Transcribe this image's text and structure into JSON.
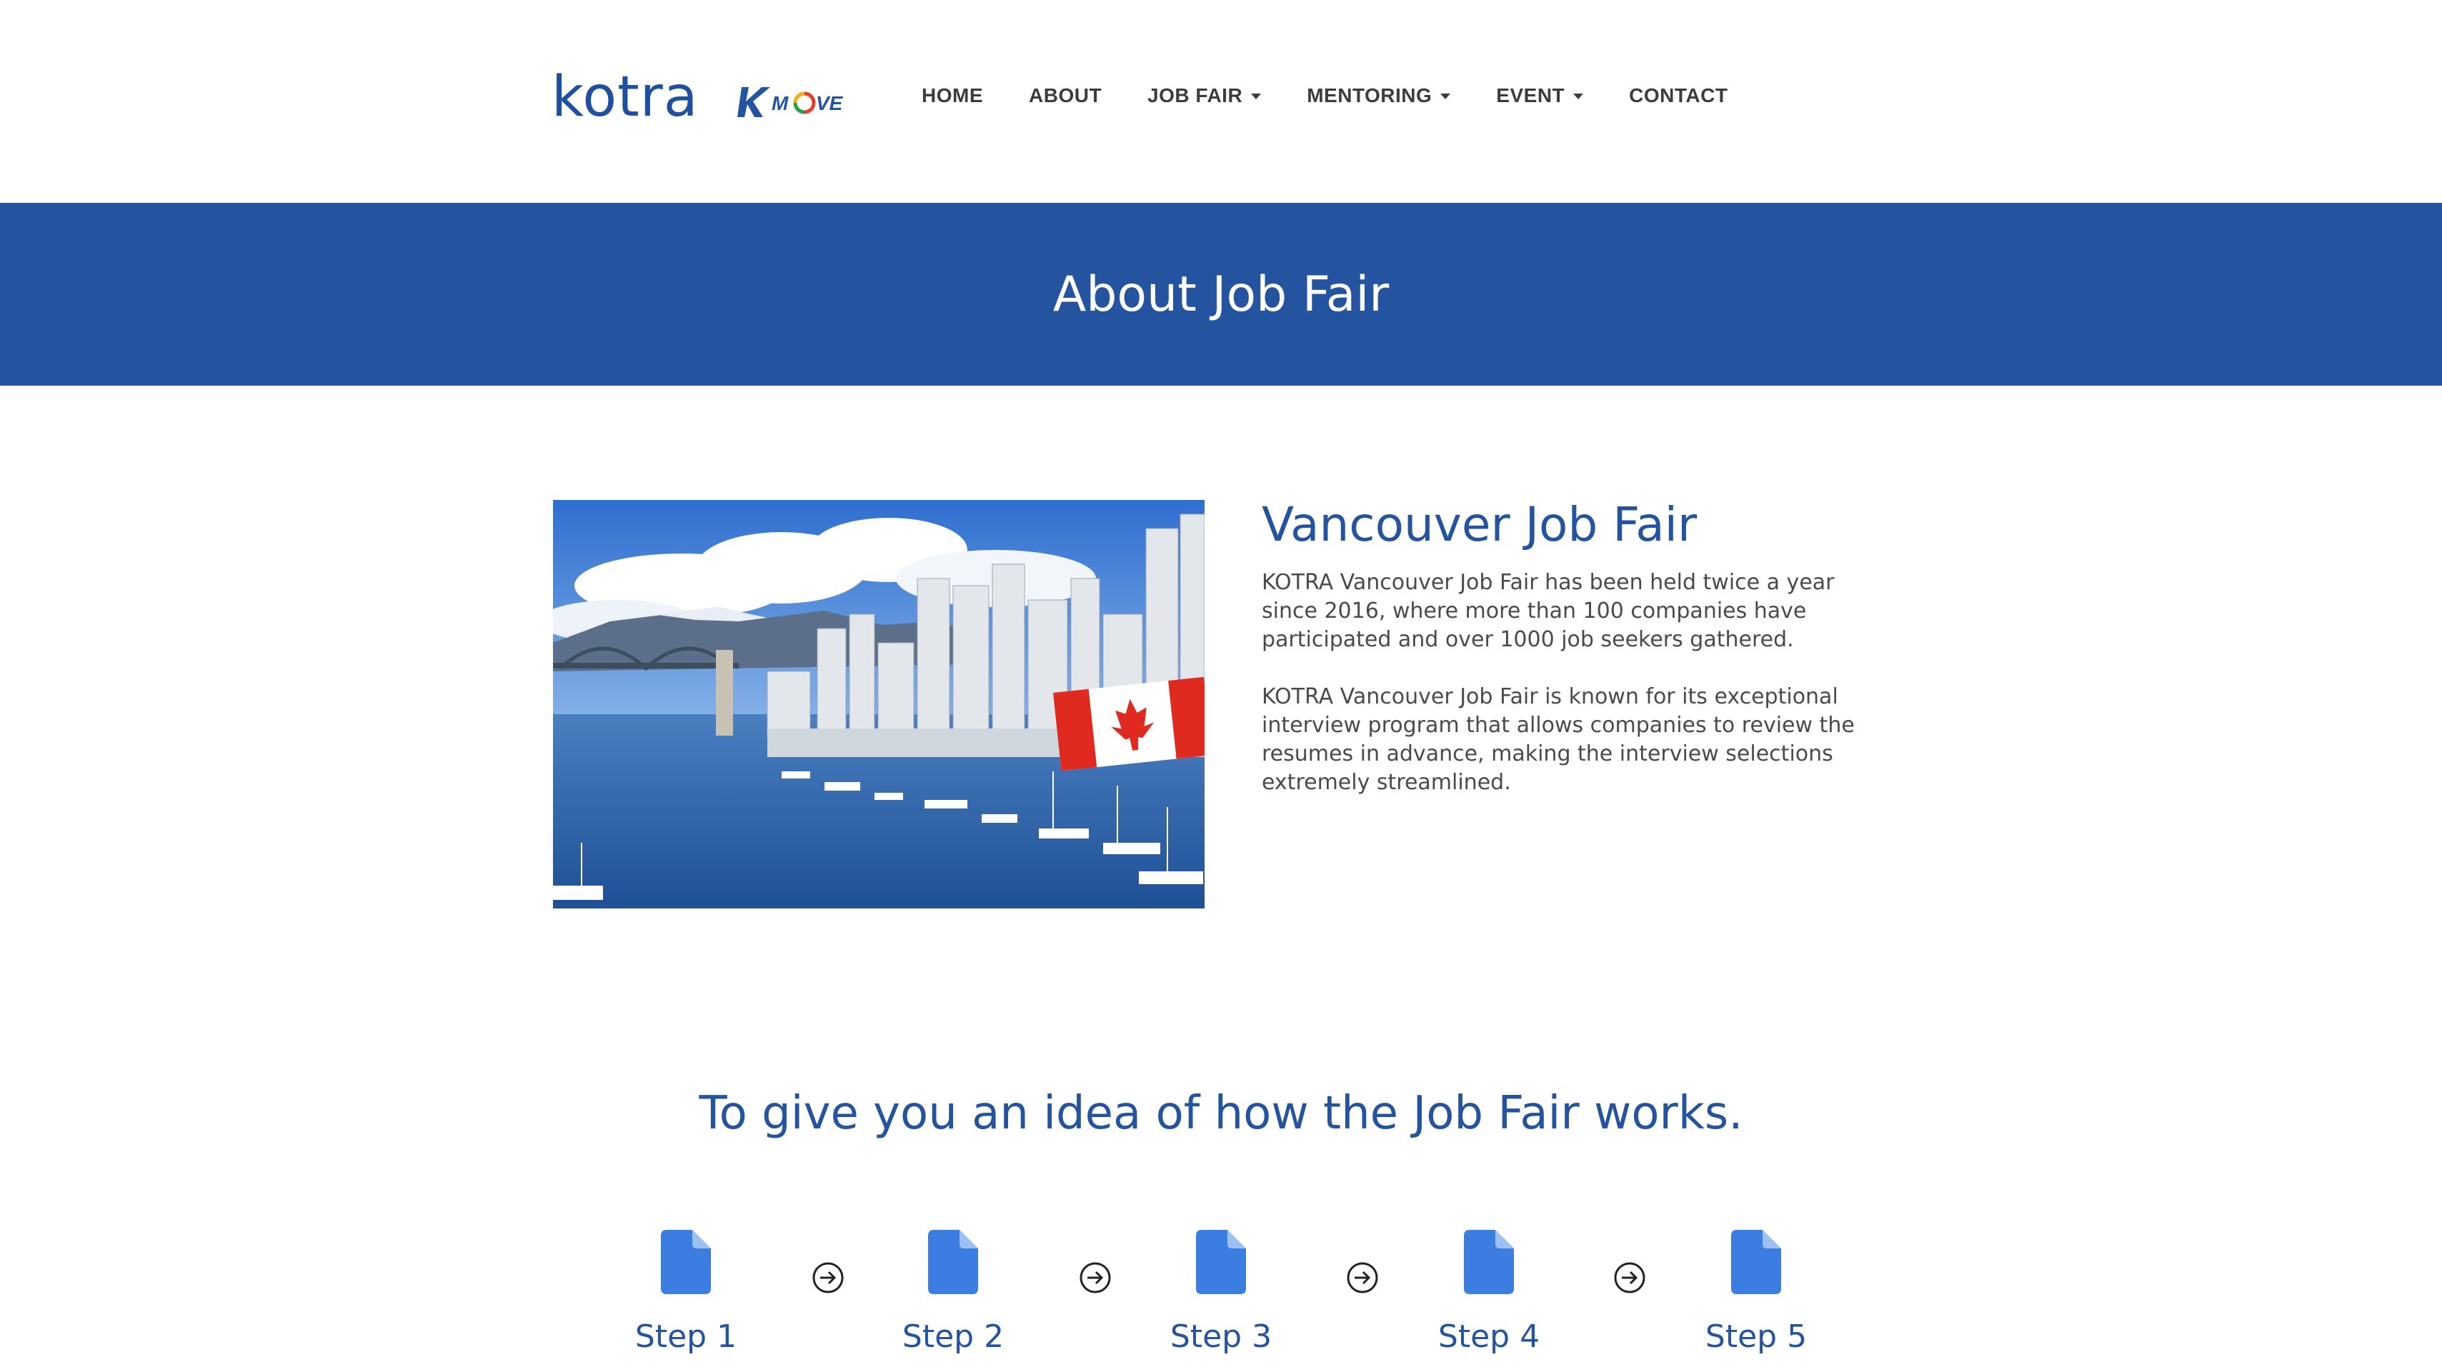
{
  "header": {
    "logo_text": "kotra",
    "kmove_logo_text": "K-MOVE",
    "nav": [
      {
        "label": "HOME",
        "dropdown": false
      },
      {
        "label": "ABOUT",
        "dropdown": false
      },
      {
        "label": "JOB FAIR",
        "dropdown": true
      },
      {
        "label": "MENTORING",
        "dropdown": true
      },
      {
        "label": "EVENT",
        "dropdown": true
      },
      {
        "label": "CONTACT",
        "dropdown": false
      }
    ]
  },
  "banner": {
    "title": "About Job Fair"
  },
  "about": {
    "heading": "Vancouver Job Fair",
    "paragraphs": [
      "KOTRA Vancouver Job Fair has been held twice a year since 2016, where more than 100 companies have participated and over 1000 job seekers gathered.",
      "KOTRA Vancouver Job Fair is known for its exceptional interview program that allows companies to review the resumes in advance, making the interview selections extremely streamlined."
    ]
  },
  "how": {
    "title": "To give you an idea of how the Job Fair works.",
    "steps": [
      {
        "label": "Step 1"
      },
      {
        "label": "Step 2"
      },
      {
        "label": "Step 3"
      },
      {
        "label": "Step 4"
      },
      {
        "label": "Step 5"
      }
    ]
  },
  "colors": {
    "brand_blue": "#2453a0",
    "step_icon_blue": "#3b7de0",
    "nav_text": "#3c3c3c"
  },
  "icons": {
    "step": "document-icon",
    "between_steps": "arrow-right-circle-icon",
    "dropdown": "caret-down-icon"
  }
}
